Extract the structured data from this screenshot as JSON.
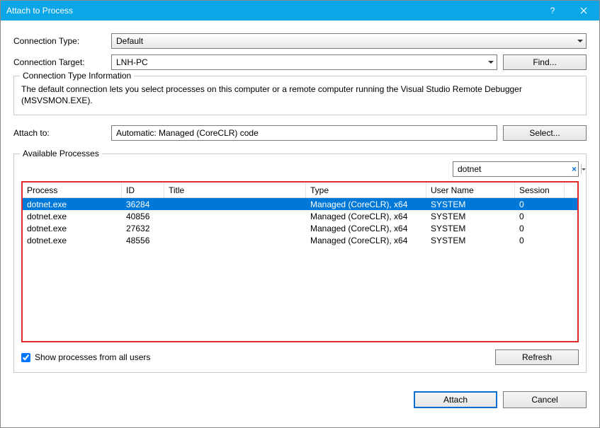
{
  "window": {
    "title": "Attach to Process"
  },
  "labels": {
    "connection_type": "Connection Type:",
    "connection_target": "Connection Target:",
    "find": "Find...",
    "info_title": "Connection Type Information",
    "info_body": "The default connection lets you select processes on this computer or a remote computer running the Visual Studio Remote Debugger (MSVSMON.EXE).",
    "attach_to": "Attach to:",
    "select": "Select...",
    "available_processes": "Available Processes",
    "show_all": "Show processes from all users",
    "refresh": "Refresh",
    "attach": "Attach",
    "cancel": "Cancel"
  },
  "values": {
    "connection_type": "Default",
    "connection_target": "LNH-PC",
    "attach_to": "Automatic: Managed (CoreCLR) code",
    "filter": "dotnet",
    "show_all_checked": true
  },
  "columns": {
    "process": "Process",
    "id": "ID",
    "title": "Title",
    "type": "Type",
    "user": "User Name",
    "session": "Session"
  },
  "processes": [
    {
      "process": "dotnet.exe",
      "id": "36284",
      "title": "",
      "type": "Managed (CoreCLR), x64",
      "user": "SYSTEM",
      "session": "0",
      "selected": true
    },
    {
      "process": "dotnet.exe",
      "id": "40856",
      "title": "",
      "type": "Managed (CoreCLR), x64",
      "user": "SYSTEM",
      "session": "0",
      "selected": false
    },
    {
      "process": "dotnet.exe",
      "id": "27632",
      "title": "",
      "type": "Managed (CoreCLR), x64",
      "user": "SYSTEM",
      "session": "0",
      "selected": false
    },
    {
      "process": "dotnet.exe",
      "id": "48556",
      "title": "",
      "type": "Managed (CoreCLR), x64",
      "user": "SYSTEM",
      "session": "0",
      "selected": false
    }
  ]
}
